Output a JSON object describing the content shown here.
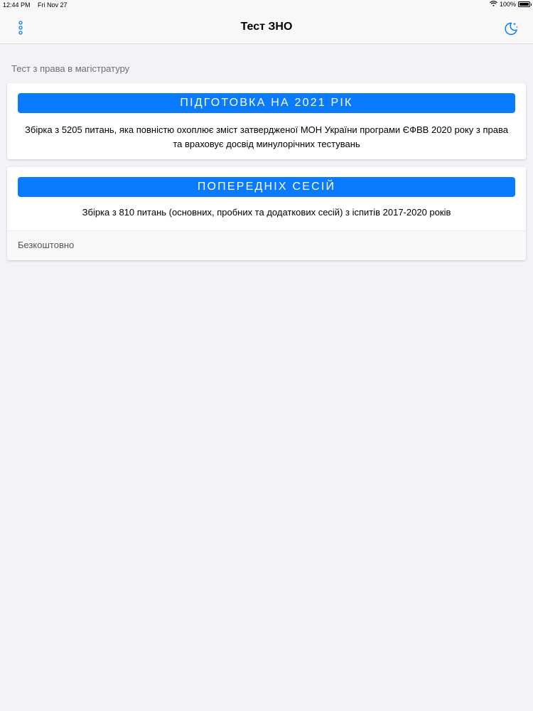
{
  "status_bar": {
    "time": "12:44 PM",
    "date": "Fri Nov 27",
    "battery": "100%",
    "icons": [
      "wifi-icon",
      "battery-icon"
    ]
  },
  "nav": {
    "title": "Тест ЗНО",
    "left_icon": "more-vertical-icon",
    "right_icon": "moon-icon"
  },
  "section_header": "Тест з права в магістратуру",
  "accent_color": "#0a7aff",
  "cards": [
    {
      "button_label": "ПІДГОТОВКА НА 2021 РІК",
      "description": "Збірка з 5205 питань, яка повністю охоплює зміст затвердженої МОН України програми ЄФВВ 2020 року з права та враховує досвід минулорічних тестувань"
    },
    {
      "button_label": "ПОПЕРЕДНІХ СЕСІЙ",
      "description": "Збірка з 810 питань (основних, пробних та додаткових сесій) з іспитів 2017-2020 років",
      "footer": "Безкоштовно"
    }
  ]
}
